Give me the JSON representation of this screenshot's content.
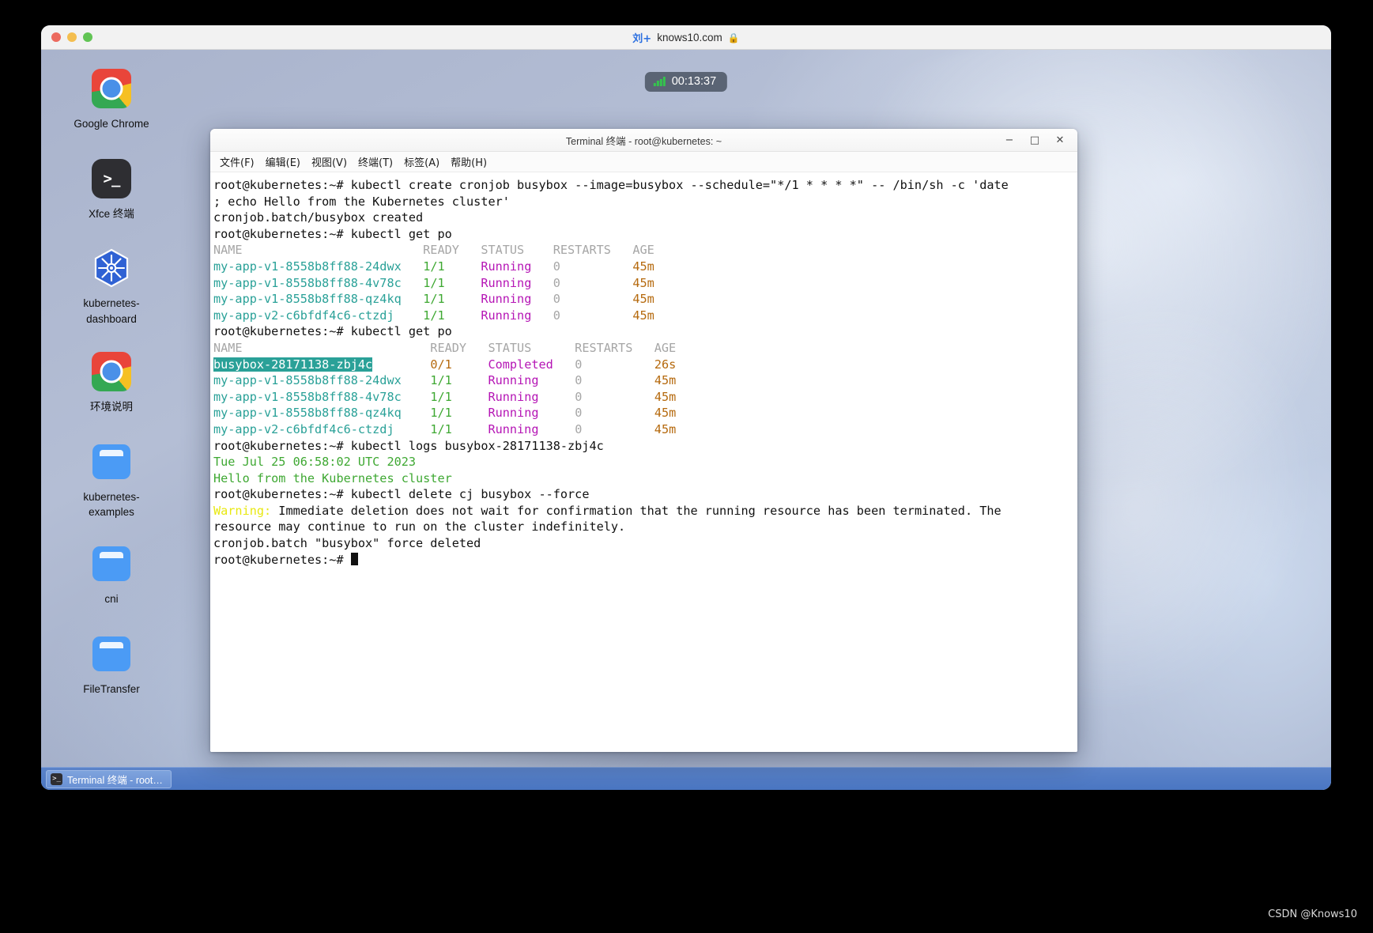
{
  "browser": {
    "site": "knows10.com",
    "favicon": "knows-icon",
    "lock": "lock-icon",
    "traffic_lights": [
      "close",
      "minimize",
      "zoom"
    ]
  },
  "timer": {
    "value": "00:13:37",
    "icon": "signal-bars-icon"
  },
  "desktop": {
    "icons": [
      {
        "label": "Google Chrome",
        "glyph": "chrome-icon"
      },
      {
        "label": "Xfce 终端",
        "glyph": "terminal-icon"
      },
      {
        "label": "kubernetes-dashboard",
        "glyph": "kubernetes-icon"
      },
      {
        "label": "环境说明",
        "glyph": "chrome-icon"
      },
      {
        "label": "kubernetes-examples",
        "glyph": "folder-icon"
      },
      {
        "label": "cni",
        "glyph": "folder-icon"
      },
      {
        "label": "FileTransfer",
        "glyph": "folder-icon"
      }
    ]
  },
  "taskbar": {
    "item_label": "Terminal 终端 - root…",
    "item_glyph": "terminal-icon"
  },
  "terminal": {
    "title": "Terminal 终端 - root@kubernetes: ~",
    "window_buttons": {
      "minimize": "−",
      "maximize": "□",
      "close": "✕"
    },
    "menu": [
      "文件(F)",
      "编辑(E)",
      "视图(V)",
      "终端(T)",
      "标签(A)",
      "帮助(H)"
    ],
    "prompt": "root@kubernetes:~# ",
    "lines": [
      {
        "id": "l01",
        "spans": [
          {
            "t": "root@kubernetes:~# kubectl create cronjob busybox --image=busybox --schedule=\"*/1 * * * *\" -- /bin/sh -c 'date",
            "c": "c-default"
          }
        ]
      },
      {
        "id": "l02",
        "spans": [
          {
            "t": "; echo Hello from the Kubernetes cluster'",
            "c": "c-default"
          }
        ]
      },
      {
        "id": "l03",
        "spans": [
          {
            "t": "cronjob.batch/busybox created",
            "c": "c-default"
          }
        ]
      },
      {
        "id": "l04",
        "spans": [
          {
            "t": "root@kubernetes:~# kubectl get po",
            "c": "c-default"
          }
        ]
      },
      {
        "id": "l05",
        "spans": [
          {
            "t": "NAME                         READY   STATUS    RESTARTS   AGE",
            "c": "c-grey"
          }
        ]
      },
      {
        "id": "l06",
        "spans": [
          {
            "t": "my-app-v1-8558b8ff88-24dwx",
            "c": "c-teal"
          },
          {
            "t": "   ",
            "c": "c-default"
          },
          {
            "t": "1/1",
            "c": "c-green"
          },
          {
            "t": "     ",
            "c": "c-default"
          },
          {
            "t": "Running",
            "c": "c-magenta"
          },
          {
            "t": "   ",
            "c": "c-default"
          },
          {
            "t": "0",
            "c": "c-grey"
          },
          {
            "t": "          ",
            "c": "c-default"
          },
          {
            "t": "45m",
            "c": "c-orange"
          }
        ]
      },
      {
        "id": "l07",
        "spans": [
          {
            "t": "my-app-v1-8558b8ff88-4v78c",
            "c": "c-teal"
          },
          {
            "t": "   ",
            "c": "c-default"
          },
          {
            "t": "1/1",
            "c": "c-green"
          },
          {
            "t": "     ",
            "c": "c-default"
          },
          {
            "t": "Running",
            "c": "c-magenta"
          },
          {
            "t": "   ",
            "c": "c-default"
          },
          {
            "t": "0",
            "c": "c-grey"
          },
          {
            "t": "          ",
            "c": "c-default"
          },
          {
            "t": "45m",
            "c": "c-orange"
          }
        ]
      },
      {
        "id": "l08",
        "spans": [
          {
            "t": "my-app-v1-8558b8ff88-qz4kq",
            "c": "c-teal"
          },
          {
            "t": "   ",
            "c": "c-default"
          },
          {
            "t": "1/1",
            "c": "c-green"
          },
          {
            "t": "     ",
            "c": "c-default"
          },
          {
            "t": "Running",
            "c": "c-magenta"
          },
          {
            "t": "   ",
            "c": "c-default"
          },
          {
            "t": "0",
            "c": "c-grey"
          },
          {
            "t": "          ",
            "c": "c-default"
          },
          {
            "t": "45m",
            "c": "c-orange"
          }
        ]
      },
      {
        "id": "l09",
        "spans": [
          {
            "t": "my-app-v2-c6bfdf4c6-ctzdj",
            "c": "c-teal"
          },
          {
            "t": "    ",
            "c": "c-default"
          },
          {
            "t": "1/1",
            "c": "c-green"
          },
          {
            "t": "     ",
            "c": "c-default"
          },
          {
            "t": "Running",
            "c": "c-magenta"
          },
          {
            "t": "   ",
            "c": "c-default"
          },
          {
            "t": "0",
            "c": "c-grey"
          },
          {
            "t": "          ",
            "c": "c-default"
          },
          {
            "t": "45m",
            "c": "c-orange"
          }
        ]
      },
      {
        "id": "l10",
        "spans": [
          {
            "t": "root@kubernetes:~# kubectl get po",
            "c": "c-default"
          }
        ]
      },
      {
        "id": "l11",
        "spans": [
          {
            "t": "NAME                          READY   STATUS      RESTARTS   AGE",
            "c": "c-grey"
          }
        ]
      },
      {
        "id": "l12",
        "spans": [
          {
            "t": "busybox-28171138-zbj4c",
            "c": "c-sel"
          },
          {
            "t": "        ",
            "c": "c-default"
          },
          {
            "t": "0/1",
            "c": "c-orange"
          },
          {
            "t": "     ",
            "c": "c-default"
          },
          {
            "t": "Completed",
            "c": "c-magenta"
          },
          {
            "t": "   ",
            "c": "c-default"
          },
          {
            "t": "0",
            "c": "c-grey"
          },
          {
            "t": "          ",
            "c": "c-default"
          },
          {
            "t": "26s",
            "c": "c-orange"
          }
        ]
      },
      {
        "id": "l13",
        "spans": [
          {
            "t": "my-app-v1-8558b8ff88-24dwx",
            "c": "c-teal"
          },
          {
            "t": "    ",
            "c": "c-default"
          },
          {
            "t": "1/1",
            "c": "c-green"
          },
          {
            "t": "     ",
            "c": "c-default"
          },
          {
            "t": "Running",
            "c": "c-magenta"
          },
          {
            "t": "     ",
            "c": "c-default"
          },
          {
            "t": "0",
            "c": "c-grey"
          },
          {
            "t": "          ",
            "c": "c-default"
          },
          {
            "t": "45m",
            "c": "c-orange"
          }
        ]
      },
      {
        "id": "l14",
        "spans": [
          {
            "t": "my-app-v1-8558b8ff88-4v78c",
            "c": "c-teal"
          },
          {
            "t": "    ",
            "c": "c-default"
          },
          {
            "t": "1/1",
            "c": "c-green"
          },
          {
            "t": "     ",
            "c": "c-default"
          },
          {
            "t": "Running",
            "c": "c-magenta"
          },
          {
            "t": "     ",
            "c": "c-default"
          },
          {
            "t": "0",
            "c": "c-grey"
          },
          {
            "t": "          ",
            "c": "c-default"
          },
          {
            "t": "45m",
            "c": "c-orange"
          }
        ]
      },
      {
        "id": "l15",
        "spans": [
          {
            "t": "my-app-v1-8558b8ff88-qz4kq",
            "c": "c-teal"
          },
          {
            "t": "    ",
            "c": "c-default"
          },
          {
            "t": "1/1",
            "c": "c-green"
          },
          {
            "t": "     ",
            "c": "c-default"
          },
          {
            "t": "Running",
            "c": "c-magenta"
          },
          {
            "t": "     ",
            "c": "c-default"
          },
          {
            "t": "0",
            "c": "c-grey"
          },
          {
            "t": "          ",
            "c": "c-default"
          },
          {
            "t": "45m",
            "c": "c-orange"
          }
        ]
      },
      {
        "id": "l16",
        "spans": [
          {
            "t": "my-app-v2-c6bfdf4c6-ctzdj",
            "c": "c-teal"
          },
          {
            "t": "     ",
            "c": "c-default"
          },
          {
            "t": "1/1",
            "c": "c-green"
          },
          {
            "t": "     ",
            "c": "c-default"
          },
          {
            "t": "Running",
            "c": "c-magenta"
          },
          {
            "t": "     ",
            "c": "c-default"
          },
          {
            "t": "0",
            "c": "c-grey"
          },
          {
            "t": "          ",
            "c": "c-default"
          },
          {
            "t": "45m",
            "c": "c-orange"
          }
        ]
      },
      {
        "id": "l17",
        "spans": [
          {
            "t": "root@kubernetes:~# kubectl logs busybox-28171138-zbj4c",
            "c": "c-default"
          }
        ]
      },
      {
        "id": "l18",
        "spans": [
          {
            "t": "Tue Jul 25 06:58:02 UTC 2023",
            "c": "c-green"
          }
        ]
      },
      {
        "id": "l19",
        "spans": [
          {
            "t": "Hello from the Kubernetes cluster",
            "c": "c-green"
          }
        ]
      },
      {
        "id": "l20",
        "spans": [
          {
            "t": "root@kubernetes:~# kubectl delete cj busybox --force",
            "c": "c-default"
          }
        ]
      },
      {
        "id": "l21",
        "spans": [
          {
            "t": "Warning:",
            "c": "c-yellow"
          },
          {
            "t": " Immediate deletion does not wait for confirmation that the running resource has been terminated. The",
            "c": "c-default"
          }
        ]
      },
      {
        "id": "l22",
        "spans": [
          {
            "t": "resource may continue to run on the cluster indefinitely.",
            "c": "c-default"
          }
        ]
      },
      {
        "id": "l23",
        "spans": [
          {
            "t": "cronjob.batch \"busybox\" force deleted",
            "c": "c-default"
          }
        ]
      },
      {
        "id": "l24",
        "spans": [
          {
            "t": "root@kubernetes:~# ",
            "c": "c-default"
          },
          {
            "t": "",
            "c": "cursor"
          }
        ]
      }
    ]
  },
  "watermark": "CSDN @Knows10",
  "colors": {
    "accent_teal": "#2aa198",
    "running_magenta": "#b515b5",
    "ready_green": "#3ea832",
    "age_orange": "#b5690d",
    "warning_yellow": "#e8e810",
    "taskbar_blue": "#4a76c2"
  }
}
